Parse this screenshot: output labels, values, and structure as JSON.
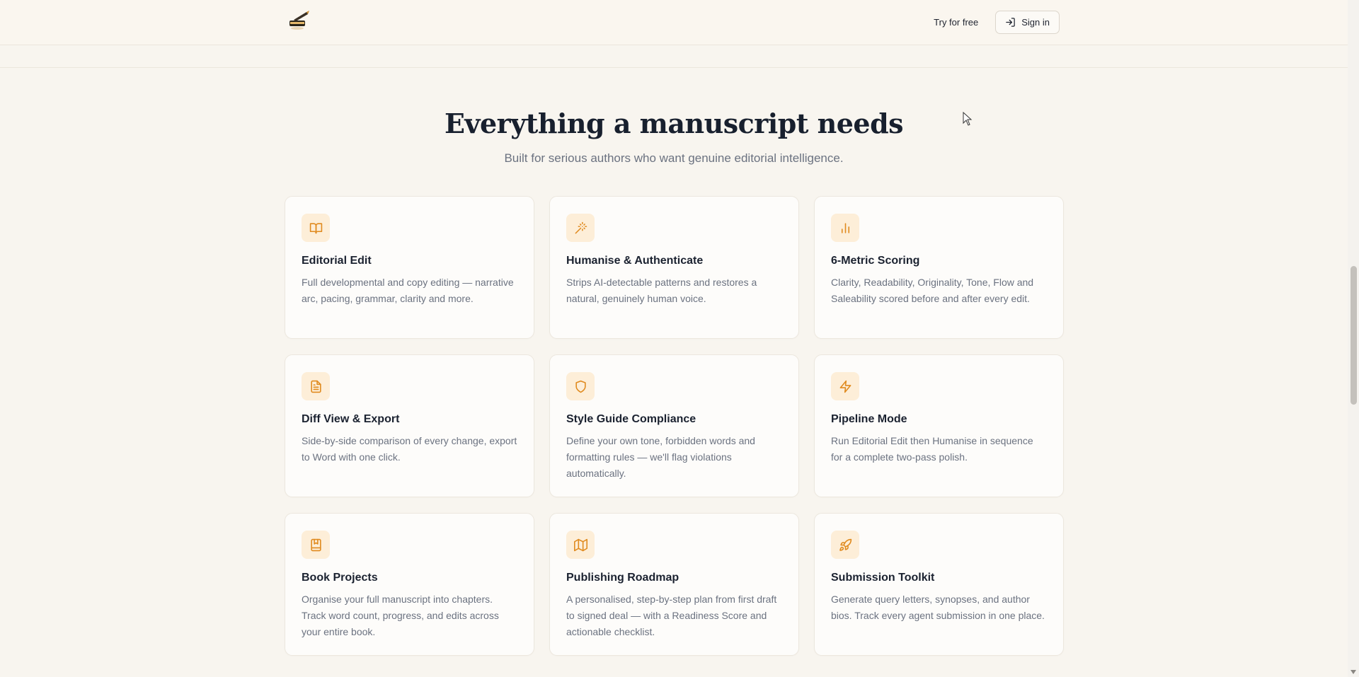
{
  "header": {
    "logo_icon": "quill-inkpot-icon",
    "try_free_label": "Try for free",
    "sign_in_label": "Sign in",
    "sign_in_icon": "sign-in-icon"
  },
  "features": {
    "heading": "Everything a manuscript needs",
    "subheading": "Built for serious authors who want genuine editorial intelligence.",
    "cards": [
      {
        "icon": "book-open-icon",
        "title": "Editorial Edit",
        "description": "Full developmental and copy editing — narrative arc, pacing, grammar, clarity and more."
      },
      {
        "icon": "magic-wand-icon",
        "title": "Humanise & Authenticate",
        "description": "Strips AI-detectable patterns and restores a natural, genuinely human voice."
      },
      {
        "icon": "bar-chart-icon",
        "title": "6-Metric Scoring",
        "description": "Clarity, Readability, Originality, Tone, Flow and Saleability scored before and after every edit."
      },
      {
        "icon": "document-icon",
        "title": "Diff View & Export",
        "description": "Side-by-side comparison of every change, export to Word with one click."
      },
      {
        "icon": "shield-icon",
        "title": "Style Guide Compliance",
        "description": "Define your own tone, forbidden words and formatting rules — we'll flag violations automatically."
      },
      {
        "icon": "lightning-icon",
        "title": "Pipeline Mode",
        "description": "Run Editorial Edit then Humanise in sequence for a complete two-pass polish."
      },
      {
        "icon": "book-bookmark-icon",
        "title": "Book Projects",
        "description": "Organise your full manuscript into chapters. Track word count, progress, and edits across your entire book."
      },
      {
        "icon": "map-icon",
        "title": "Publishing Roadmap",
        "description": "A personalised, step-by-step plan from first draft to signed deal — with a Readiness Score and actionable checklist."
      },
      {
        "icon": "rocket-icon",
        "title": "Submission Toolkit",
        "description": "Generate query letters, synopses, and author bios. Track every agent submission in one place."
      }
    ]
  },
  "colors": {
    "page_background": "#f8f5ef",
    "icon_accent": "#e08a1e",
    "icon_background": "#fdeed8"
  }
}
